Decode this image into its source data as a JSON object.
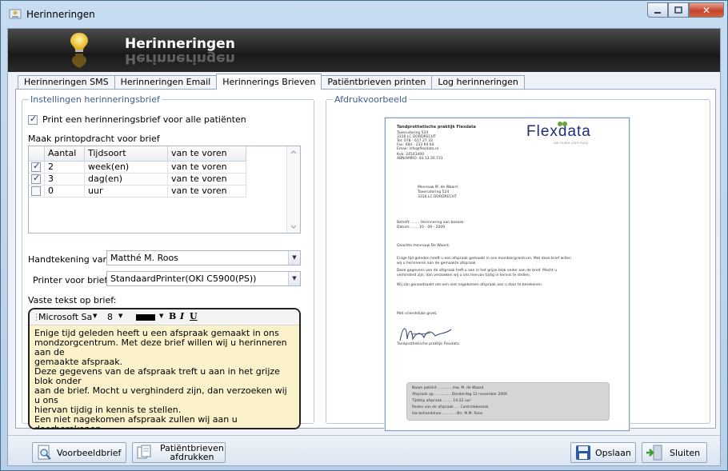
{
  "window": {
    "title": "Herinneringen",
    "close_glyph": "✕"
  },
  "banner": {
    "title": "Herinneringen",
    "icon": "lightbulb-icon"
  },
  "tabs": [
    {
      "label": "Herinneringen SMS",
      "active": false
    },
    {
      "label": "Herinneringen Email",
      "active": false
    },
    {
      "label": "Herinnerings Brieven",
      "active": true
    },
    {
      "label": "Patiëntbrieven printen",
      "active": false
    },
    {
      "label": "Log herinneringen",
      "active": false
    }
  ],
  "settings": {
    "legend": "Instellingen herinneringsbrief",
    "print_all_label": "Print een herinneringsbrief voor alle patiënten",
    "print_all_checked": true,
    "print_job_label": "Maak printopdracht voor brief",
    "grid": {
      "headers": [
        "Aantal",
        "Tijdsoort",
        "van te voren"
      ],
      "rows": [
        {
          "checked": true,
          "aantal": "2",
          "tijdsoort": "week(en)",
          "vooraf": "van te voren"
        },
        {
          "checked": true,
          "aantal": "3",
          "tijdsoort": "dag(en)",
          "vooraf": "van te voren"
        },
        {
          "checked": false,
          "aantal": "0",
          "tijdsoort": "uur",
          "vooraf": "van te voren"
        }
      ]
    },
    "signature_label": "Handtekening van:",
    "signature_value": "Matthé M. Roos",
    "printer_label": "Printer voor brief:",
    "printer_value": "StandaardPrinter(OKI C5900(PS))",
    "fixed_text_label": "Vaste tekst op brief:",
    "editor": {
      "font": "Microsoft Sa",
      "size": "8",
      "bold": "B",
      "italic": "I",
      "underline": "U",
      "text": "Enige tijd geleden heeft u een afspraak gemaakt in ons\nmondzorgcentrum. Met deze brief willen wij u herinneren aan de\ngemaakte afspraak.\nDeze gegevens van de afspraak treft u aan in het grijze blok onder\naan de brief. Mocht u verghinderd zijn, dan verzoeken wij u ons\nhiervan tijdig in kennis te stellen.\nEen niet nagekomen afspraak zullen wij aan u doorberekenen."
    }
  },
  "preview": {
    "legend": "Afdrukvoorbeeld",
    "practice_name": "Tandprothetische praktijk Flexdata",
    "address_lines": [
      "Taxerudoring 524",
      "3316 LC DORDRECHT",
      "Tel: 078 - 617 27 33",
      "Fax: 084 - 233 64 64",
      "Email: info@flexdata.nl"
    ],
    "bank_lines": [
      "Kvk: 24543400",
      "ABN/AMRO: 44.13.30.731"
    ],
    "logo_text": "Flexdata",
    "logo_tagline": "we make care easy",
    "recipient": [
      "Mevrouw M. de Waard",
      "Taxerudoring 524",
      "3316 LC DORDRECHT"
    ],
    "subject_lines": [
      "Betreft: ....... Herinnering aan bezoek",
      "Datum: ...... 10 - 09 - 2009"
    ],
    "salutation": "Geachte mevrouw De Waard,",
    "para1": [
      "Enige tijd geleden heeft u een afspraak gemaakt in ons mondzorgcentrum. Met deze brief willen",
      "wij u herinneren aan de gemaakte afspraak."
    ],
    "para2": [
      "Deze gegevens van de afspraak treft u aan in het grijze blok onder aan de brief. Mocht u",
      "verhinderd zijn, dan verzoeken wij u ons hiervan tijdig in kennis te stellen."
    ],
    "para3": "Wij zijn genoodzaakt om een niet nagekomen afspraak aan u door te berekenen.",
    "closing": "Met vriendelijke groet,",
    "signature_name": "Tandprothetische praktijk Flexdata",
    "info_box": [
      "Naam patiënt ............ mw. M. de Waard",
      "Afspraak op .............. Donderdag 12 november 2009",
      "Tijdstip afspraak ........ 14:22 uur",
      "Reden van de afspraak .... Controlebezoek",
      "Uw behandelaar ........... dhr. M.M. Roos"
    ]
  },
  "footer": {
    "preview_button": "Voorbeeldbrief",
    "print_button_line1": "Patiëntbrieven",
    "print_button_line2": "afdrukken",
    "save_button": "Opslaan",
    "close_button": "Sluiten"
  }
}
